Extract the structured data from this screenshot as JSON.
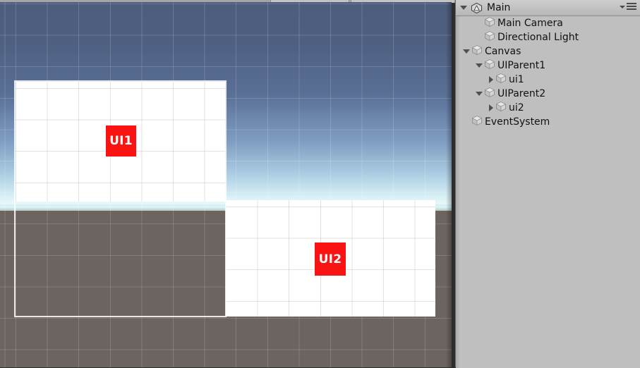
{
  "window": {
    "scene_view_name": "scene-view",
    "grid_spacing_px": 44.6
  },
  "hierarchy": {
    "title": "Main",
    "logo_icon": "unity-logo-icon",
    "fold_icon": "chevron-down-icon",
    "menu_icon": "panel-options-menu-icon",
    "items": [
      {
        "label": "Main Camera",
        "indent": 2,
        "toggle": "none",
        "icon": "gameobject-cube-icon"
      },
      {
        "label": "Directional Light",
        "indent": 2,
        "toggle": "none",
        "icon": "gameobject-cube-icon"
      },
      {
        "label": "Canvas",
        "indent": 1,
        "toggle": "down",
        "icon": "gameobject-cube-icon"
      },
      {
        "label": "UIParent1",
        "indent": 2,
        "toggle": "down",
        "icon": "gameobject-cube-icon"
      },
      {
        "label": "ui1",
        "indent": 3,
        "toggle": "right",
        "icon": "gameobject-cube-icon"
      },
      {
        "label": "UIParent2",
        "indent": 2,
        "toggle": "down",
        "icon": "gameobject-cube-icon"
      },
      {
        "label": "ui2",
        "indent": 3,
        "toggle": "right",
        "icon": "gameobject-cube-icon"
      },
      {
        "label": "EventSystem",
        "indent": 1,
        "toggle": "none",
        "icon": "gameobject-cube-icon"
      }
    ]
  },
  "scene": {
    "elements": [
      {
        "name": "UI1",
        "label": "UI1"
      },
      {
        "name": "UI2",
        "label": "UI2"
      }
    ]
  },
  "colors": {
    "ui_element_red": "#fa1313",
    "panel_white": "#ffffff",
    "sky_top": "#4d5d7e",
    "ground": "#6b6460",
    "hierarchy_bg": "#bfbfbf",
    "selection_outline": "#ffffff"
  }
}
